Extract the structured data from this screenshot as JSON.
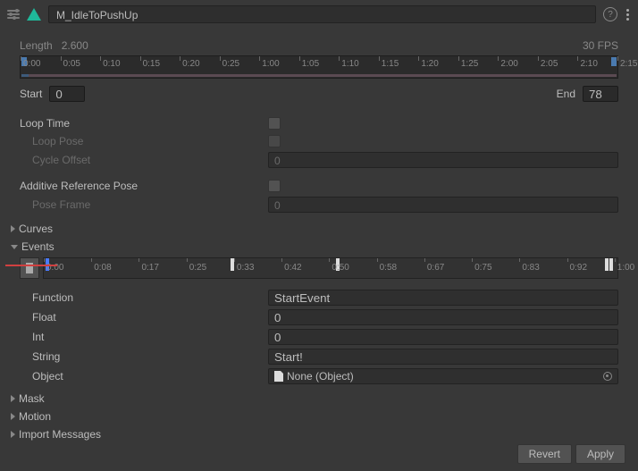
{
  "header": {
    "title": "M_IdleToPushUp"
  },
  "clip": {
    "length_label": "Length",
    "length_value": "2.600",
    "fps_label": "30 FPS",
    "start_label": "Start",
    "start_value": "0",
    "end_label": "End",
    "end_value": "78"
  },
  "timeline_ticks": [
    "0:00",
    "0:05",
    "0:10",
    "0:15",
    "0:20",
    "0:25",
    "1:00",
    "1:05",
    "1:10",
    "1:15",
    "1:20",
    "1:25",
    "2:00",
    "2:05",
    "2:10",
    "2:15"
  ],
  "props": {
    "loop_time": "Loop Time",
    "loop_pose": "Loop Pose",
    "cycle_offset": "Cycle Offset",
    "cycle_offset_value": "0",
    "additive_ref": "Additive Reference Pose",
    "pose_frame": "Pose Frame",
    "pose_frame_value": "0"
  },
  "foldouts": {
    "curves": "Curves",
    "events": "Events",
    "mask": "Mask",
    "motion": "Motion",
    "import_messages": "Import Messages"
  },
  "events_ticks": [
    "0:00",
    "0:08",
    "0:17",
    "0:25",
    "0:33",
    "0:42",
    "0:50",
    "0:58",
    "0:67",
    "0:75",
    "0:83",
    "0:92",
    "1:00"
  ],
  "event": {
    "function_label": "Function",
    "function_value": "StartEvent",
    "float_label": "Float",
    "float_value": "0",
    "int_label": "Int",
    "int_value": "0",
    "string_label": "String",
    "string_value": "Start!",
    "object_label": "Object",
    "object_value": "None (Object)"
  },
  "footer": {
    "revert": "Revert",
    "apply": "Apply"
  }
}
